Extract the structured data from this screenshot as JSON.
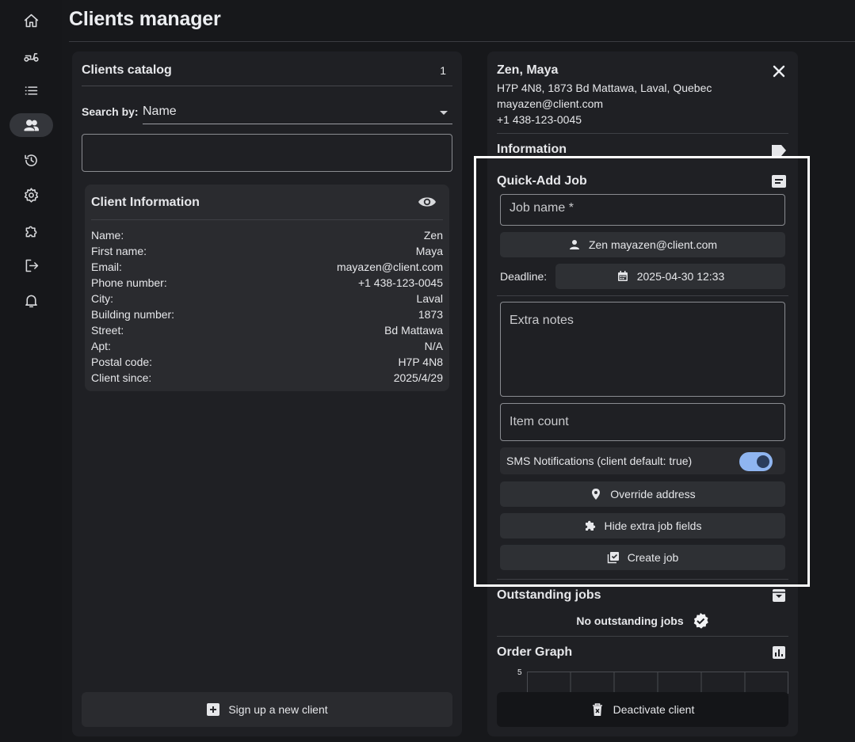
{
  "page_title": "Clients manager",
  "sidebar": {
    "items": [
      {
        "name": "home",
        "icon": "home-icon"
      },
      {
        "name": "delivery",
        "icon": "scooter-icon"
      },
      {
        "name": "list",
        "icon": "list-icon"
      },
      {
        "name": "clients",
        "icon": "people-icon",
        "active": true
      },
      {
        "name": "history",
        "icon": "history-icon"
      },
      {
        "name": "settings",
        "icon": "gear-icon"
      },
      {
        "name": "extensions",
        "icon": "puzzle-icon"
      },
      {
        "name": "logout",
        "icon": "logout-icon"
      },
      {
        "name": "notifications",
        "icon": "bell-icon"
      }
    ]
  },
  "catalog": {
    "title": "Clients catalog",
    "count": "1",
    "search_label": "Search by:",
    "search_by": "Name",
    "search_value": ""
  },
  "client_info": {
    "title": "Client Information",
    "rows": [
      {
        "label": "Name:",
        "value": "Zen"
      },
      {
        "label": "First name:",
        "value": "Maya"
      },
      {
        "label": "Email:",
        "value": "mayazen@client.com"
      },
      {
        "label": "Phone number:",
        "value": "+1 438-123-0045"
      },
      {
        "label": "City:",
        "value": "Laval"
      },
      {
        "label": "Building number:",
        "value": "1873"
      },
      {
        "label": "Street:",
        "value": "Bd Mattawa"
      },
      {
        "label": "Apt:",
        "value": "N/A"
      },
      {
        "label": "Postal code:",
        "value": "H7P 4N8"
      },
      {
        "label": "Client since:",
        "value": "2025/4/29"
      }
    ]
  },
  "signup_label": "Sign up a new client",
  "client": {
    "name": "Zen, Maya",
    "address": "H7P 4N8, 1873 Bd Mattawa, Laval, Quebec",
    "email": "mayazen@client.com",
    "phone": "+1 438-123-0045"
  },
  "sections": {
    "information": "Information",
    "quick_add": "Quick-Add Job",
    "outstanding": "Outstanding jobs",
    "order_graph": "Order Graph"
  },
  "quick_add": {
    "job_name_placeholder": "Job name *",
    "client_chip": "Zen mayazen@client.com",
    "deadline_label": "Deadline:",
    "deadline_value": "2025-04-30 12:33",
    "notes_placeholder": "Extra notes",
    "item_count_placeholder": "Item count",
    "sms_label": "SMS Notifications (client default: true)",
    "sms_enabled": true,
    "override_address": "Override address",
    "hide_fields": "Hide extra job fields",
    "create_job": "Create job"
  },
  "outstanding_empty": "No outstanding jobs",
  "graph_ymax": "5",
  "deactivate_label": "Deactivate client"
}
